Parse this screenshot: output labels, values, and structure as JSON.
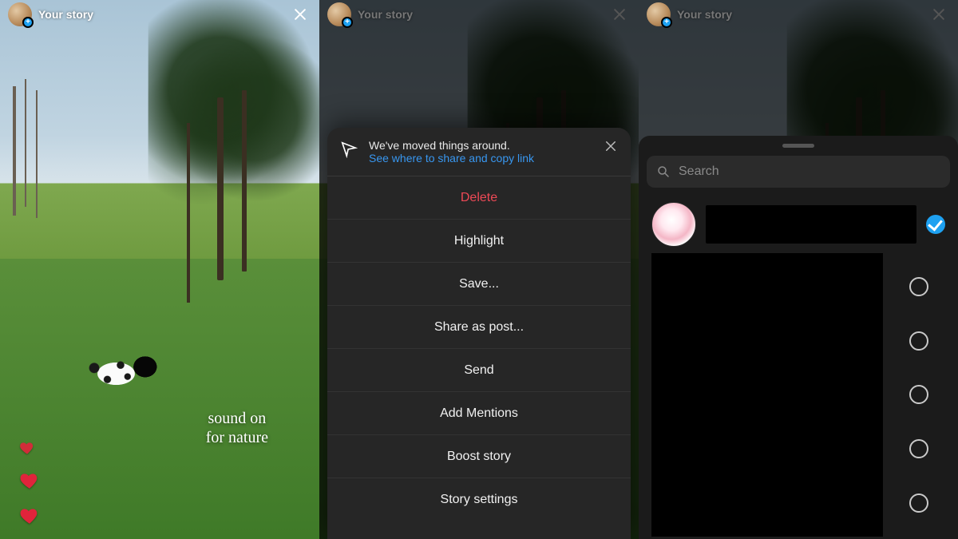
{
  "header": {
    "title": "Your story",
    "close_label": "Close"
  },
  "screen1": {
    "caption_line1": "sound on",
    "caption_line2": "for nature"
  },
  "sheet": {
    "banner_text": "We've moved things around.",
    "banner_link": "See where to share and copy link",
    "items": [
      {
        "label": "Delete",
        "danger": true
      },
      {
        "label": "Highlight"
      },
      {
        "label": "Save..."
      },
      {
        "label": "Share as post..."
      },
      {
        "label": "Send"
      },
      {
        "label": "Add Mentions"
      },
      {
        "label": "Boost story"
      },
      {
        "label": "Story settings"
      }
    ]
  },
  "share": {
    "search_placeholder": "Search",
    "recipients": [
      {
        "selected": true
      },
      {
        "selected": false
      },
      {
        "selected": false
      },
      {
        "selected": false
      },
      {
        "selected": false
      },
      {
        "selected": false
      }
    ]
  },
  "colors": {
    "danger": "#ed4956",
    "link": "#3897f0",
    "accent_check": "#1ea1f1"
  }
}
